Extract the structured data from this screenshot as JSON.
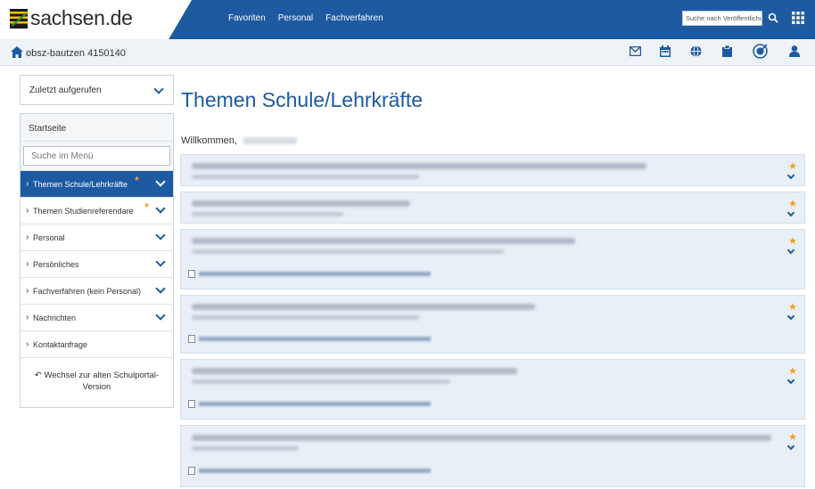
{
  "brand": {
    "logo_text": "sachsen.de"
  },
  "topnav": {
    "items": [
      "Favoriten",
      "Personal",
      "Fachverfahren"
    ]
  },
  "search": {
    "placeholder": "Suche nach Veröffentlichu"
  },
  "subbar": {
    "title": "obsz-bautzen 4150140"
  },
  "sidebar": {
    "recent_label": "Zuletzt aufgerufen",
    "start_label": "Startseite",
    "search_placeholder": "Suche im Menü",
    "items": [
      {
        "label": "Themen Schule/Lehrkräfte",
        "active": true,
        "star": true
      },
      {
        "label": "Themen Studienreferendare",
        "active": false,
        "star": true
      },
      {
        "label": "Personal",
        "active": false,
        "star": false
      },
      {
        "label": "Persönliches",
        "active": false,
        "star": false
      },
      {
        "label": "Fachverfahren (kein Personal)",
        "active": false,
        "star": false
      },
      {
        "label": "Nachrichten",
        "active": false,
        "star": false
      },
      {
        "label": "Kontaktanfrage",
        "active": false,
        "star": false
      }
    ],
    "old_portal": "Wechsel zur alten Schulportal-Version"
  },
  "main": {
    "title": "Themen Schule/Lehrkräfte",
    "welcome": "Willkommen,"
  },
  "colors": {
    "brand_blue": "#1d5aa2",
    "star_orange": "#f0a020",
    "card_bg": "#e9eff6"
  }
}
